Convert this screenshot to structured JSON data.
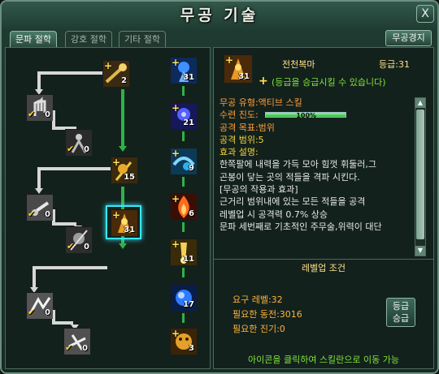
{
  "window": {
    "title": "무공 기술",
    "close_label": "X"
  },
  "tabs": [
    "문파 절학",
    "강호 절학",
    "기타 절학"
  ],
  "mastery_button": "무공경지",
  "tree": {
    "left": [
      {
        "id": "L1",
        "level": "2",
        "check": false,
        "plus": true,
        "color": "#c9a23a"
      },
      {
        "id": "L2",
        "level": "0",
        "check": true,
        "plus": false,
        "color": "#b8b8b8"
      },
      {
        "id": "L3",
        "level": "0",
        "check": true,
        "plus": false,
        "color": "#9a9a9a"
      },
      {
        "id": "L4",
        "level": "15",
        "check": false,
        "plus": true,
        "color": "#c9a23a"
      },
      {
        "id": "L5",
        "level": "0",
        "check": true,
        "plus": false,
        "color": "#b8b8b8"
      },
      {
        "id": "L6",
        "level": "0",
        "check": true,
        "plus": false,
        "color": "#8f8f8f"
      },
      {
        "id": "L7",
        "level": "31",
        "check": false,
        "plus": true,
        "color": "#d38a2a"
      },
      {
        "id": "L8",
        "level": "0",
        "check": true,
        "plus": false,
        "color": "#c8c8c8"
      },
      {
        "id": "L9",
        "level": "0",
        "check": true,
        "plus": false,
        "color": "#c8c8c8"
      }
    ],
    "right": [
      {
        "id": "R1",
        "level": "31",
        "plus": true,
        "color": "#2d78d6"
      },
      {
        "id": "R2",
        "level": "21",
        "plus": true,
        "color": "#3457c9"
      },
      {
        "id": "R3",
        "level": "9",
        "plus": true,
        "color": "#2fa6e0"
      },
      {
        "id": "R4",
        "level": "6",
        "plus": true,
        "color": "#d9531f"
      },
      {
        "id": "R5",
        "level": "11",
        "plus": true,
        "color": "#e0b43a"
      },
      {
        "id": "R6",
        "level": "17",
        "plus": false,
        "color": "#2b6fd8"
      },
      {
        "id": "R7",
        "level": "3",
        "plus": true,
        "color": "#d6a02a"
      }
    ]
  },
  "skill": {
    "icon_level": "31",
    "name": "전천복마",
    "grade": "등급:31",
    "promote_notice": "(등급을 승급시킬 수 있습니다)",
    "type": "무공 유형:액티브 스킬",
    "progress_label": "수련 진도:",
    "progress_text": "100%",
    "progress_value": 1.0,
    "target": "공격 목표:범위",
    "range": "공격 범위:5",
    "effect_title": "효과 설명:",
    "desc1": "한쪽팔에 내력을 가득 모아 힘껏 휘둘러,그",
    "desc2": "곤봉이 닿는 곳의 적들을 격파 시킨다.",
    "effect_header": "[무공의 작용과 효과]",
    "effect1": "근거리 범위내에 있는 모든 적들을 공격",
    "effect2": "레벨업 시 공격력 0.7% 상승",
    "effect3": "문파 세번째로 기초적인 주무술,위력이 대단"
  },
  "levelup": {
    "title": "레벨업 조건",
    "req_level": "요구 레벨:32",
    "req_money": "필요한 동전:3016",
    "req_energy": "필요한 진기:0",
    "promote_button": [
      "등급",
      "승급"
    ],
    "hint": "아이콘을 클릭하여 스킬란으로 이동 가능"
  }
}
